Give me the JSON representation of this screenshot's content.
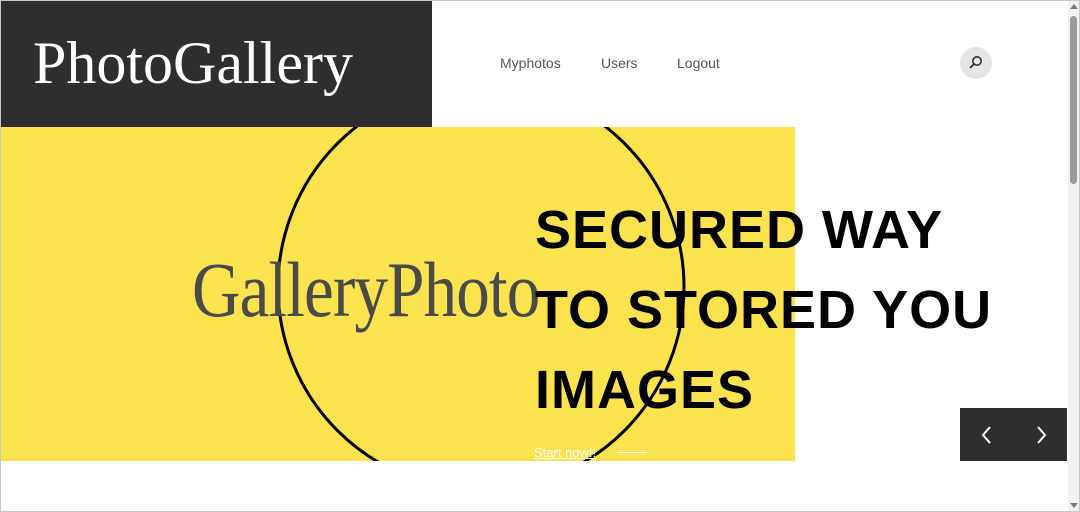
{
  "header": {
    "logo_text": "PhotoGallery",
    "nav": [
      {
        "label": "Myphotos"
      },
      {
        "label": "Users"
      },
      {
        "label": "Logout"
      }
    ],
    "search_icon": "search-icon"
  },
  "hero": {
    "image_logo_text": "GalleryPhoto",
    "headline_lines": [
      "SECURED WAY",
      "TO STORED YOU",
      "IMAGES"
    ],
    "cta_label": "Start now!!",
    "background_color": "#fbe24f"
  },
  "slider": {
    "prev_icon": "chevron-left-icon",
    "next_icon": "chevron-right-icon"
  },
  "colors": {
    "dark": "#2e2e2e",
    "accent": "#fbe24f"
  }
}
